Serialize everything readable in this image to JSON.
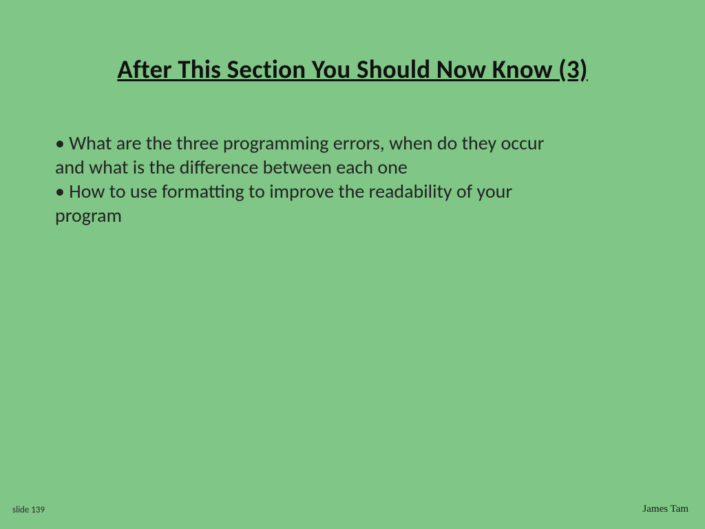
{
  "slide": {
    "title": "After This Section You Should Now Know (3)",
    "bullets": [
      {
        "lead": "• What are the three programming errors, when do they occur",
        "cont": "and what is the difference between each one"
      },
      {
        "lead": "• How to use formatting to improve the readability of your",
        "cont": "program"
      }
    ],
    "footer_left": "slide 139",
    "footer_right": "James Tam"
  }
}
